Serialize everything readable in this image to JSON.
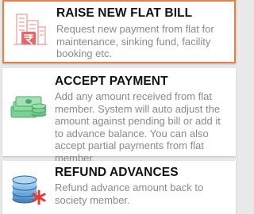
{
  "list": {
    "items": [
      {
        "title": "RAISE NEW FLAT BILL",
        "description": "Request new payment from flat for maintenance, sinking fund, facility booking etc.",
        "icon": "building-bill-icon",
        "selected": true
      },
      {
        "title": "ACCEPT PAYMENT",
        "description": "Add any amount received from flat member. System will auto adjust the amount against pending bill or add it to advance balance. You can also accept partial payments from flat member.",
        "icon": "money-stack-icon",
        "selected": false
      },
      {
        "title": "REFUND ADVANCES",
        "description": "Refund advance amount back to society member.",
        "icon": "coin-stack-refund-icon",
        "selected": false
      }
    ]
  },
  "colors": {
    "selected_border": "#ef7d3b",
    "title_text": "#111111",
    "description_text": "#8a8a8a",
    "background": "#e9e9e9",
    "card": "#ffffff"
  }
}
